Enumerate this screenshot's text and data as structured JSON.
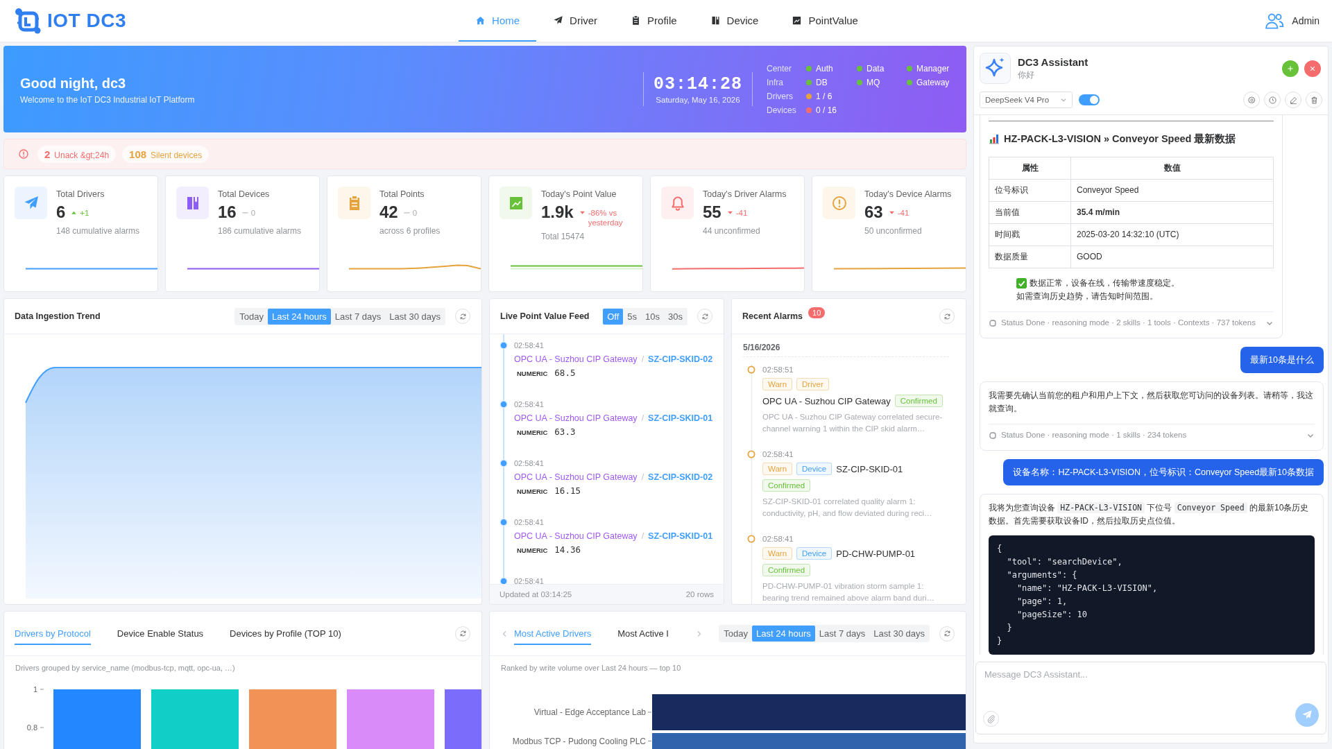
{
  "header": {
    "logo": "IOT DC3",
    "nav": [
      {
        "label": "Home",
        "selected": true
      },
      {
        "label": "Driver",
        "selected": false
      },
      {
        "label": "Profile",
        "selected": false
      },
      {
        "label": "Device",
        "selected": false
      },
      {
        "label": "PointValue",
        "selected": false
      }
    ],
    "user": "Admin"
  },
  "banner": {
    "greeting": "Good night, dc3",
    "subtitle": "Welcome to the IoT DC3 Industrial IoT Platform",
    "time": "03:14:28",
    "date": "Saturday, May 16, 2026",
    "status_rows": [
      {
        "label": "Center",
        "items": [
          {
            "name": "Auth",
            "color": "#67c23a"
          },
          {
            "name": "Data",
            "color": "#67c23a"
          },
          {
            "name": "Manager",
            "color": "#67c23a"
          }
        ]
      },
      {
        "label": "Infra",
        "items": [
          {
            "name": "DB",
            "color": "#67c23a"
          },
          {
            "name": "MQ",
            "color": "#67c23a"
          },
          {
            "name": "Gateway",
            "color": "#67c23a"
          }
        ]
      },
      {
        "label": "Drivers",
        "items": [
          {
            "name": "1 / 6",
            "color": "#e6a23c"
          }
        ]
      },
      {
        "label": "Devices",
        "items": [
          {
            "name": "0 / 16",
            "color": "#f56c6c"
          }
        ]
      }
    ]
  },
  "alerts": [
    {
      "count": "2",
      "label": "Unack &gt;24h",
      "color": "#f56c6c"
    },
    {
      "count": "108",
      "label": "Silent devices",
      "color": "#e6a23c"
    }
  ],
  "stats": [
    {
      "title": "Total Drivers",
      "value": "6",
      "delta": {
        "kind": "up",
        "text": "+1"
      },
      "note": "148 cumulative alarms",
      "color": "#409eff"
    },
    {
      "title": "Total Devices",
      "value": "16",
      "delta": {
        "kind": "flat",
        "text": "0"
      },
      "note": "186 cumulative alarms",
      "color": "#8b5cf6"
    },
    {
      "title": "Total Points",
      "value": "42",
      "delta": {
        "kind": "flat",
        "text": "0"
      },
      "note": "across 6 profiles",
      "color": "#e6a23c"
    },
    {
      "title": "Today's Point Value",
      "value": "1.9k",
      "delta": {
        "kind": "down",
        "text": "-86% vs yesterday"
      },
      "note": "Total 15474",
      "color": "#67c23a"
    },
    {
      "title": "Today's Driver Alarms",
      "value": "55",
      "delta": {
        "kind": "down",
        "text": "-41"
      },
      "note": "44 unconfirmed",
      "color": "#f56c6c"
    },
    {
      "title": "Today's Device Alarms",
      "value": "63",
      "delta": {
        "kind": "down",
        "text": "-41"
      },
      "note": "50 unconfirmed",
      "color": "#e6a23c"
    }
  ],
  "ingestion_trend": {
    "title": "Data Ingestion Trend",
    "ranges": [
      {
        "label": "Today",
        "selected": false
      },
      {
        "label": "Last 24 hours",
        "selected": true
      },
      {
        "label": "Last 7 days",
        "selected": false
      },
      {
        "label": "Last 30 days",
        "selected": false
      }
    ]
  },
  "live_feed": {
    "title": "Live Point Value Feed",
    "intervals": [
      {
        "label": "Off",
        "selected": true
      },
      {
        "label": "5s",
        "selected": false
      },
      {
        "label": "10s",
        "selected": false
      },
      {
        "label": "30s",
        "selected": false
      }
    ],
    "entries": [
      {
        "time": "02:58:41",
        "driver": "OPC UA - Suzhou CIP Gateway",
        "separator": "/",
        "device": "SZ-CIP-SKID-02",
        "type": "NUMERIC",
        "value": "68.5"
      },
      {
        "time": "02:58:41",
        "driver": "OPC UA - Suzhou CIP Gateway",
        "separator": "/",
        "device": "SZ-CIP-SKID-01",
        "type": "NUMERIC",
        "value": "63.3"
      },
      {
        "time": "02:58:41",
        "driver": "OPC UA - Suzhou CIP Gateway",
        "separator": "/",
        "device": "SZ-CIP-SKID-02",
        "type": "NUMERIC",
        "value": "16.15"
      },
      {
        "time": "02:58:41",
        "driver": "OPC UA - Suzhou CIP Gateway",
        "separator": "/",
        "device": "SZ-CIP-SKID-01",
        "type": "NUMERIC",
        "value": "14.36"
      },
      {
        "time": "02:58:41"
      }
    ],
    "updated": "Updated at 03:14:25",
    "rows": "20 rows"
  },
  "recent_alarms": {
    "title": "Recent Alarms",
    "count": "10",
    "date": "5/16/2026",
    "items": [
      {
        "time": "02:58:51",
        "tags": [
          {
            "label": "Warn",
            "color": "#e6a23c"
          },
          {
            "label": "Driver",
            "color": "#e6a23c"
          }
        ],
        "name": "OPC UA - Suzhou CIP Gateway",
        "status": "Confirmed",
        "confirmed": true,
        "description": "OPC UA - Suzhou CIP Gateway correlated secure-channel warning 1 within the CIP skid alarm…"
      },
      {
        "time": "02:58:41",
        "tags": [
          {
            "label": "Warn",
            "color": "#e6a23c"
          },
          {
            "label": "Device",
            "color": "#409eff"
          }
        ],
        "name": "SZ-CIP-SKID-01",
        "status": "Confirmed",
        "confirmed": true,
        "description": "SZ-CIP-SKID-01 correlated quality alarm 1: conductivity, pH, and flow deviated during reci…"
      },
      {
        "time": "02:58:41",
        "tags": [
          {
            "label": "Warn",
            "color": "#e6a23c"
          },
          {
            "label": "Device",
            "color": "#409eff"
          }
        ],
        "name": "PD-CHW-PUMP-01",
        "status": "Confirmed",
        "confirmed": true,
        "description": "PD-CHW-PUMP-01 vibration storm sample 1: bearing trend remained above alarm band duri…"
      }
    ]
  },
  "distribution": {
    "tabs": [
      {
        "label": "Drivers by Protocol",
        "selected": true
      },
      {
        "label": "Device Enable Status",
        "selected": false
      },
      {
        "label": "Devices by Profile (TOP 10)",
        "selected": false
      }
    ],
    "caption": "Drivers grouped by service_name (modbus-tcp, mqtt, opc-ua, …)",
    "axis_labels": [
      "1",
      "0.8"
    ]
  },
  "activity": {
    "tabs": [
      {
        "label": "Most Active Drivers",
        "selected": true
      },
      {
        "label": "Most Active I",
        "selected": false
      }
    ],
    "ranges": [
      {
        "label": "Today",
        "selected": false
      },
      {
        "label": "Last 24 hours",
        "selected": true
      },
      {
        "label": "Last 7 days",
        "selected": false
      },
      {
        "label": "Last 30 days",
        "selected": false
      }
    ],
    "caption": "Ranked by write volume over Last 24 hours — top 10",
    "bar_labels": [
      "Virtual - Edge Acceptance Lab",
      "Modbus TCP - Pudong Cooling PLC"
    ]
  },
  "assistant": {
    "title": "DC3 Assistant",
    "subtitle": "你好",
    "model": "DeepSeek V4 Pro",
    "reasoning_on": true,
    "messages": [
      {
        "kind": "assistant",
        "blocks": [
          {
            "kind": "rule"
          },
          {
            "kind": "heading",
            "text": "HZ-PACK-L3-VISION » Conveyor Speed 最新数据"
          },
          {
            "kind": "table",
            "columns": [
              "属性",
              "数值"
            ],
            "rows": [
              {
                "attribute": "位号标识",
                "value": "Conveyor Speed",
                "emphasis": false
              },
              {
                "attribute": "当前值",
                "value": "35.4 m/min",
                "emphasis": true
              },
              {
                "attribute": "时间戳",
                "value": "2025-03-20 14:32:10 (UTC)",
                "emphasis": false
              },
              {
                "attribute": "数据质量",
                "value": "GOOD",
                "emphasis": false
              }
            ]
          },
          {
            "kind": "note",
            "lines": [
              "数据正常，设备在线，传输带速度稳定。",
              "如需查询历史趋势，请告知时间范围。"
            ]
          }
        ],
        "status": "Status Done · reasoning mode · 2 skills · 1 tools · Contexts · 737 tokens"
      },
      {
        "kind": "user",
        "text": "最新10条是什么"
      },
      {
        "kind": "assistant",
        "blocks": [
          {
            "kind": "paragraph",
            "segments": [
              {
                "kind": "text",
                "text": "我需要先确认当前您的租户和用户上下文，然后获取您可访问的设备列表。请稍等，我这就查询。"
              }
            ]
          }
        ],
        "status": "Status Done · reasoning mode · 1 skills · 234 tokens"
      },
      {
        "kind": "user",
        "text": "设备名称：HZ-PACK-L3-VISION，位号标识：Conveyor Speed最新10条数据"
      },
      {
        "kind": "assistant",
        "blocks": [
          {
            "kind": "paragraph",
            "segments": [
              {
                "kind": "text",
                "text": "我将为您查询设备 "
              },
              {
                "kind": "code",
                "text": "HZ-PACK-L3-VISION"
              },
              {
                "kind": "text",
                "text": " 下位号 "
              },
              {
                "kind": "code",
                "text": "Conveyor Speed"
              },
              {
                "kind": "text",
                "text": " 的最新10条历史数据。首先需要获取设备ID，然后拉取历史点位值。"
              }
            ]
          },
          {
            "kind": "code",
            "text": "{\n  \"tool\": \"searchDevice\",\n  \"arguments\": {\n    \"name\": \"HZ-PACK-L3-VISION\",\n    \"page\": 1,\n    \"pageSize\": 10\n  }\n}"
          }
        ]
      }
    ],
    "placeholder": "Message DC3 Assistant..."
  }
}
